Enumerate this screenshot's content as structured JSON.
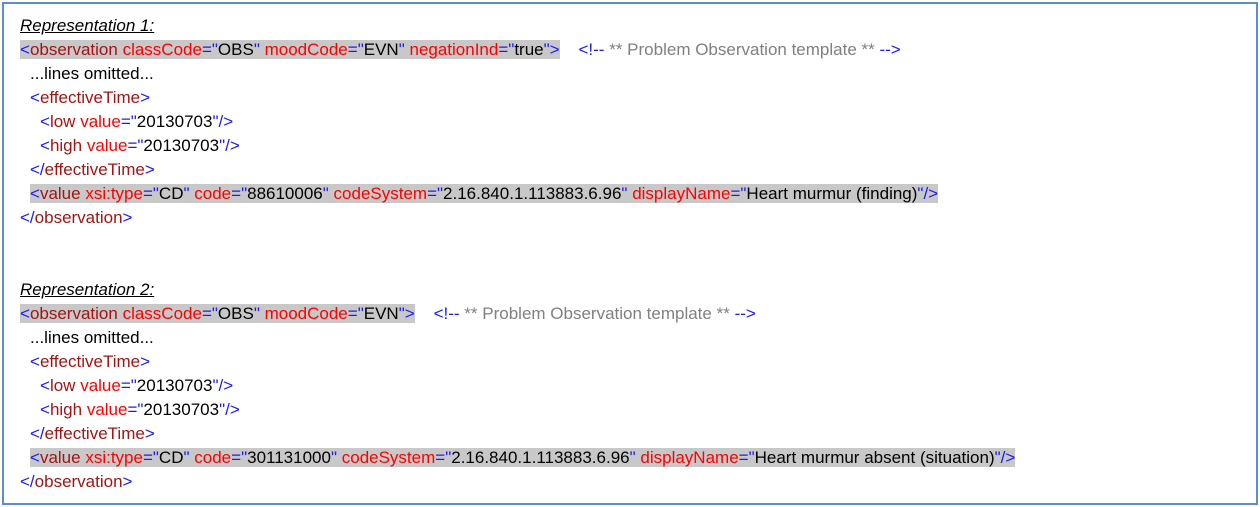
{
  "representations": [
    {
      "heading": "Representation 1:",
      "observation_tag": "observation",
      "observation_attrs": [
        {
          "name": "classCode",
          "value": "OBS"
        },
        {
          "name": "moodCode",
          "value": "EVN"
        },
        {
          "name": "negationInd",
          "value": "true"
        }
      ],
      "comment": "** Problem Observation template **",
      "omitted": "...lines omitted...",
      "effective_time_tag": "effectiveTime",
      "low": {
        "tag": "low",
        "attr": "value",
        "value": "20130703"
      },
      "high": {
        "tag": "high",
        "attr": "value",
        "value": "20130703"
      },
      "value_tag": "value",
      "value_attrs": [
        {
          "name": "xsi:type",
          "value": "CD"
        },
        {
          "name": "code",
          "value": "88610006"
        },
        {
          "name": "codeSystem",
          "value": "2.16.840.1.113883.6.96"
        },
        {
          "name": "displayName",
          "value": "Heart murmur (finding)"
        }
      ]
    },
    {
      "heading": "Representation 2:",
      "observation_tag": "observation",
      "observation_attrs": [
        {
          "name": "classCode",
          "value": "OBS"
        },
        {
          "name": "moodCode",
          "value": "EVN"
        }
      ],
      "comment": "** Problem Observation template **",
      "omitted": "...lines omitted...",
      "effective_time_tag": "effectiveTime",
      "low": {
        "tag": "low",
        "attr": "value",
        "value": "20130703"
      },
      "high": {
        "tag": "high",
        "attr": "value",
        "value": "20130703"
      },
      "value_tag": "value",
      "value_attrs": [
        {
          "name": "xsi:type",
          "value": "CD"
        },
        {
          "name": "code",
          "value": "301131000"
        },
        {
          "name": "codeSystem",
          "value": "2.16.840.1.113883.6.96"
        },
        {
          "name": "displayName",
          "value": "Heart murmur absent (situation)"
        }
      ]
    }
  ],
  "colors": {
    "bracket": "#1c1cf0",
    "element": "#a31515",
    "attribute": "#ff0000",
    "attribute_value": "#000000",
    "comment": "#808080",
    "highlight": "#c8c8c8",
    "frame_border": "#5b8fc9"
  }
}
